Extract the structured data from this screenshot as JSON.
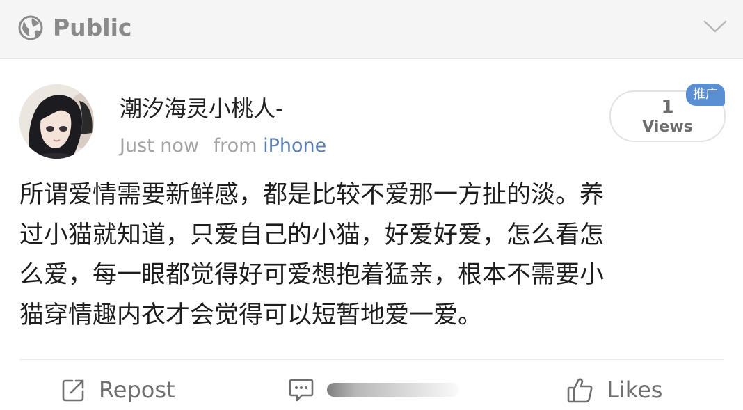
{
  "header": {
    "visibility_icon": "globe-icon",
    "visibility_label": "Public",
    "menu_icon": "chevron-down-icon"
  },
  "post": {
    "author": "潮汐海灵小桃人-",
    "time": "Just now",
    "from_prefix": "from",
    "source": "iPhone",
    "views_count": "1",
    "views_label": "Views",
    "ad_badge": "推广",
    "body_lines": [
      "所谓爱情需要新鲜感，都是比较不爱那一方扯的淡。养",
      "过小猫就知道，只爱自己的小猫，好爱好爱，怎么看怎",
      "么爱，每一眼都觉得好可爱想抱着猛亲，根本不需要小",
      "猫穿情趣内衣才会觉得可以短暂地爱一爱。"
    ]
  },
  "actions": {
    "repost_label": "Repost",
    "repost_icon": "repost-icon",
    "comment_icon": "comment-icon",
    "likes_label": "Likes",
    "likes_icon": "thumbs-up-icon"
  },
  "colors": {
    "link_blue": "#5b7fb0",
    "badge_blue": "#5b8fd3",
    "muted_gray": "#a3a3a3"
  }
}
